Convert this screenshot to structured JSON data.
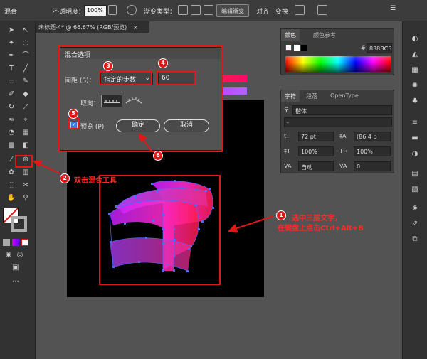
{
  "topbar": {
    "group_label": "混合",
    "opacity_label": "不透明度：",
    "opacity_value": "100%",
    "gradient_type_label": "渐变类型：",
    "edit_gradient_button": "编辑渐变",
    "align_label": "对齐",
    "transform_label": "变换"
  },
  "document_tab": {
    "title": "未标题-4* @ 66.67% (RGB/预览)"
  },
  "blend_dialog": {
    "title": "混合选项",
    "spacing_label": "间距 (S)：",
    "spacing_value": "指定的步数",
    "steps_value": "60",
    "orientation_label": "取向：",
    "preview_label": "预览 (P)",
    "preview_checked": true,
    "ok_button": "确定",
    "cancel_button": "取消"
  },
  "annotations": {
    "badges": [
      "1",
      "2",
      "3",
      "4",
      "5",
      "6"
    ],
    "step2_text": "双击混合工具",
    "step1_line1": "选中三层文字，",
    "step1_line2": "在键盘上点击Ctrl+Alt+B",
    "color": "#e01818"
  },
  "color_panel": {
    "tabs": [
      "颜色",
      "颜色参考"
    ],
    "hex_value": "838BC5"
  },
  "character_panel": {
    "tabs": [
      "字符",
      "段落",
      "OpenType"
    ],
    "font_family": "楷体",
    "font_style": "-",
    "font_size": "72 pt",
    "leading": "(86.4 p",
    "horizontal_scale": "100%",
    "vertical_scale": "100%",
    "kerning": "自动",
    "tracking": "0"
  },
  "icons": {
    "tools": [
      "selection-icon",
      "direct-selection-icon",
      "magic-wand-icon",
      "lasso-icon",
      "pen-icon",
      "curvature-icon",
      "type-icon",
      "line-icon",
      "rectangle-icon",
      "paintbrush-icon",
      "shaper-icon",
      "eraser-icon",
      "rotate-icon",
      "scale-icon",
      "width-icon",
      "free-transform-icon",
      "shape-builder-icon",
      "perspective-icon",
      "mesh-icon",
      "gradient-icon",
      "eyedropper-icon",
      "blend-icon",
      "symbol-sprayer-icon",
      "column-graph-icon",
      "artboard-icon",
      "slice-icon",
      "hand-icon",
      "zoom-icon"
    ]
  }
}
